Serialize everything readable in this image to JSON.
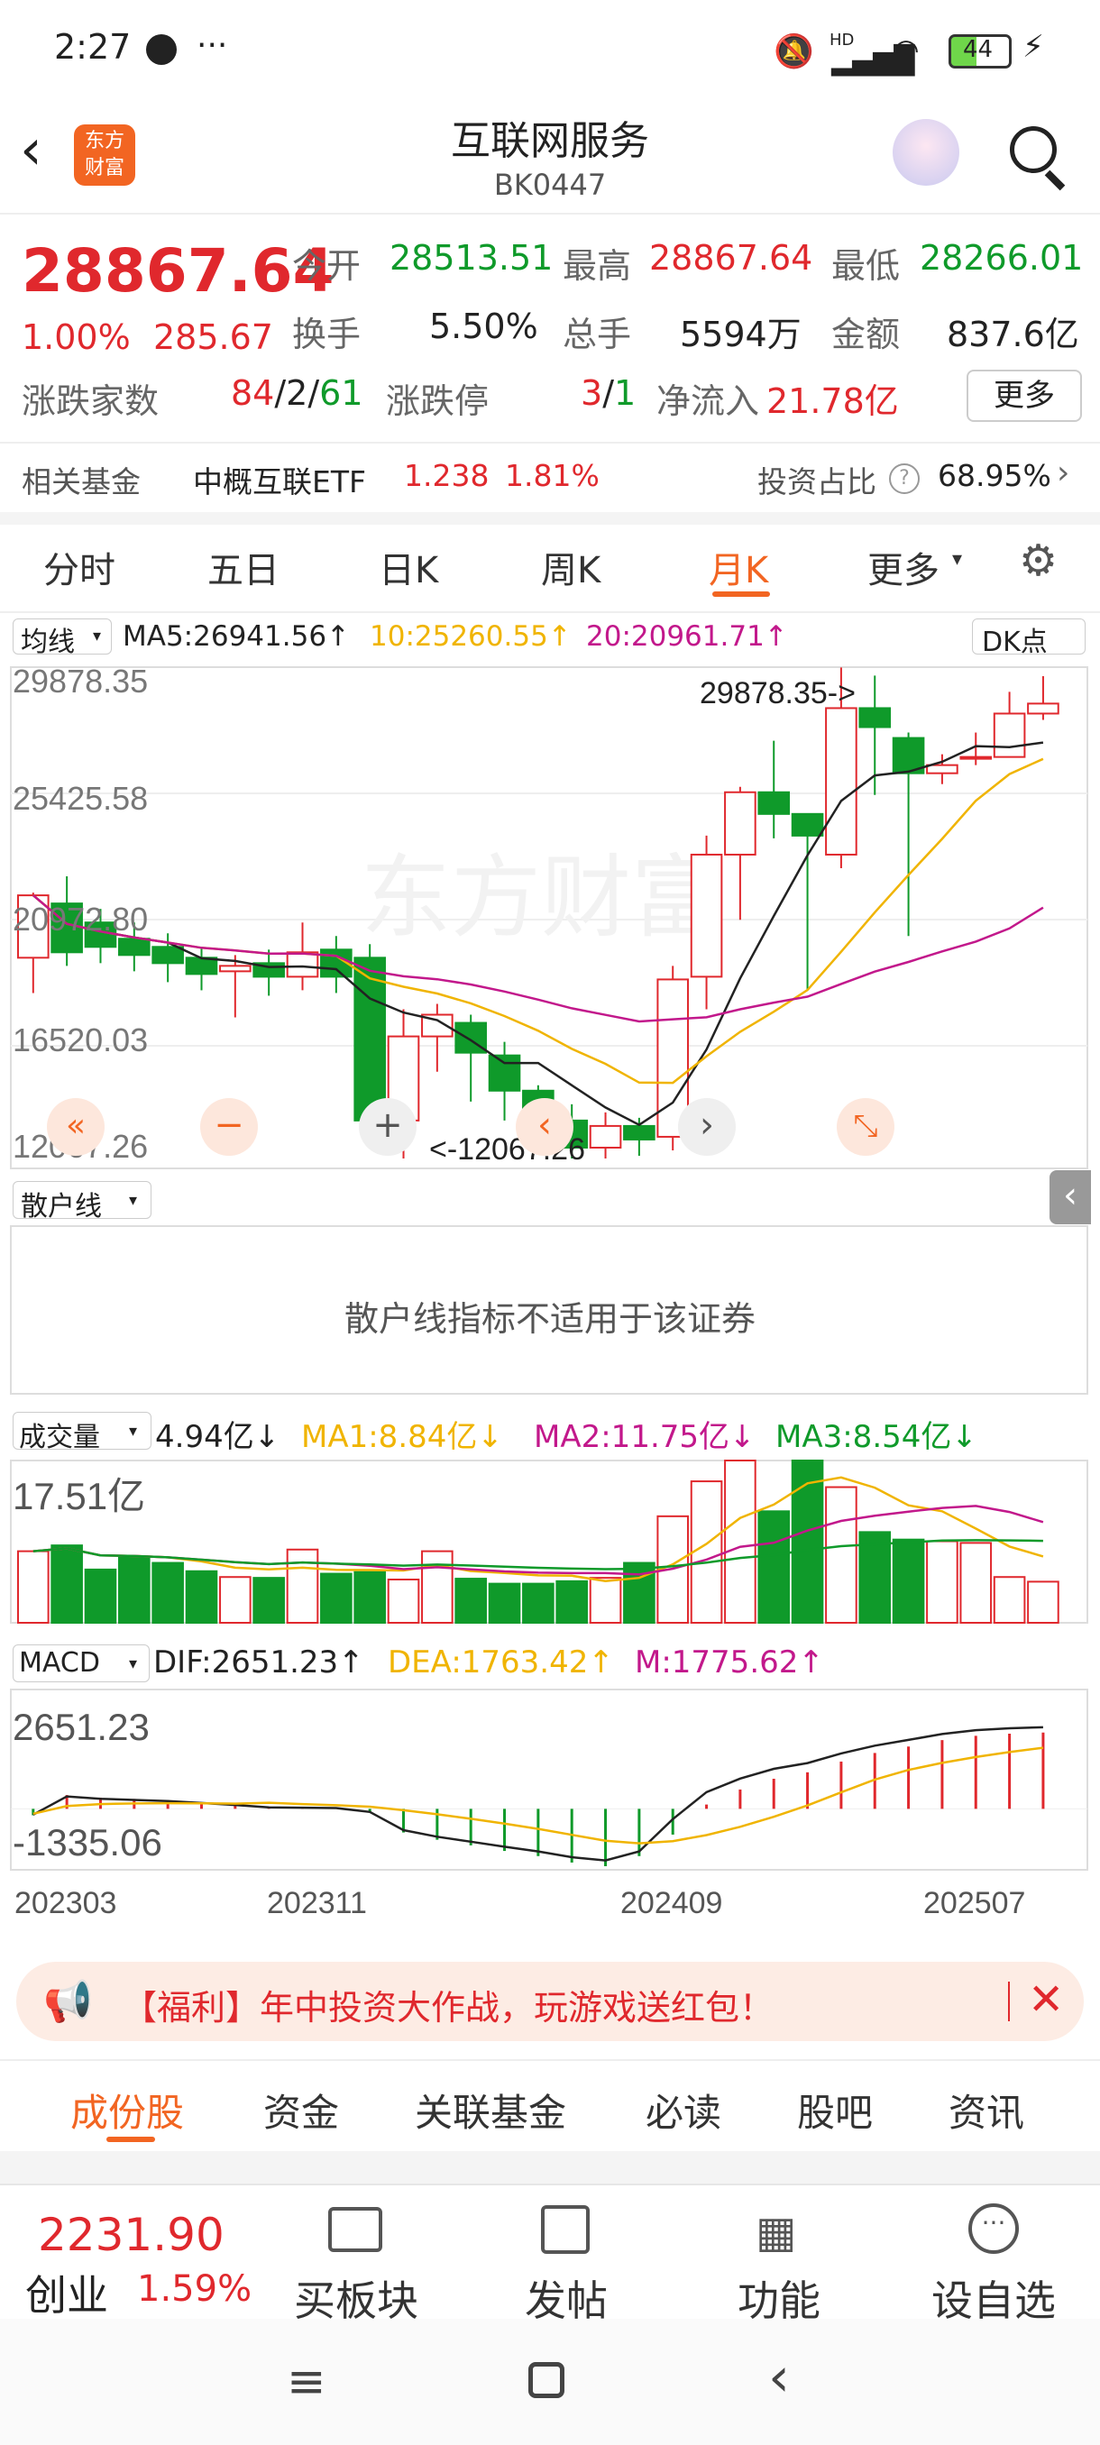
{
  "status_bar": {
    "time": "2:27",
    "dots": "···",
    "battery": "44",
    "net": "HD"
  },
  "header": {
    "title": "互联网服务",
    "code": "BK0447",
    "logo_line1": "东方",
    "logo_line2": "财富"
  },
  "quote": {
    "price": "28867.64",
    "pct": "1.00%",
    "change": "285.67",
    "open_label": "今开",
    "open": "28513.51",
    "high_label": "最高",
    "high": "28867.64",
    "low_label": "最低",
    "low": "28266.01",
    "turnover_label": "换手",
    "turnover": "5.50%",
    "volume_label": "总手",
    "volume": "5594万",
    "amount_label": "金额",
    "amount": "837.6亿",
    "updown_label": "涨跌家数",
    "up": "84",
    "flat": "2",
    "down": "61",
    "limit_label": "涨跌停",
    "limit_up": "3",
    "limit_down": "1",
    "inflow_label": "净流入",
    "inflow": "21.78亿",
    "more": "更多"
  },
  "fund": {
    "label": "相关基金",
    "name": "中概互联ETF",
    "price": "1.238",
    "pct": "1.81%",
    "ratio_label": "投资占比",
    "ratio": "68.95%"
  },
  "chart_tabs": [
    "分时",
    "五日",
    "日K",
    "周K",
    "月K",
    "更多"
  ],
  "active_tab": "月K",
  "ma": {
    "selector": "均线",
    "ma5": "MA5:26941.56↑",
    "ma10": "10:25260.55↑",
    "ma20": "20:20961.71↑",
    "dk": "DK点"
  },
  "kline": {
    "y_labels": [
      "29878.35",
      "25425.58",
      "20972.80",
      "16520.03",
      "12067.26"
    ],
    "max_note": "29878.35->",
    "min_note": "<-12067.26"
  },
  "retail": {
    "selector": "散户线",
    "message": "散户线指标不适用于该证券"
  },
  "volume": {
    "selector": "成交量",
    "value": "4.94亿↓",
    "ma1": "MA1:8.84亿↓",
    "ma2": "MA2:11.75亿↓",
    "ma3": "MA3:8.54亿↓",
    "y_label": "17.51亿"
  },
  "macd": {
    "selector": "MACD",
    "dif": "DIF:2651.23↑",
    "dea": "DEA:1763.42↑",
    "m": "M:1775.62↑",
    "top": "2651.23",
    "bottom": "-1335.06"
  },
  "x_dates": [
    "202303",
    "202311",
    "202409",
    "202507"
  ],
  "banner": {
    "text": "【福利】年中投资大作战，玩游戏送红包！"
  },
  "sub_tabs": [
    "成份股",
    "资金",
    "关联基金",
    "必读",
    "股吧",
    "资讯"
  ],
  "bottom_nav": {
    "index_price": "2231.90",
    "index_name": "创业",
    "index_pct": "1.59%",
    "items": [
      "买板块",
      "发帖",
      "功能",
      "设自选"
    ]
  },
  "colors": {
    "up": "#e0282d",
    "down": "#0f9a2a",
    "accent": "#f26522",
    "ma10": "#f0b400",
    "ma20": "#c2188b"
  },
  "chart_data": [
    {
      "type": "candlestick",
      "title": "",
      "period": "monthly",
      "series": [
        {
          "name": "K",
          "values": [
            [
              19500,
              21800,
              21900,
              18200
            ],
            [
              21500,
              19700,
              22500,
              19200
            ],
            [
              20800,
              19900,
              21300,
              19300
            ],
            [
              20200,
              19600,
              20800,
              19000
            ],
            [
              19900,
              19300,
              20400,
              18600
            ],
            [
              19500,
              18900,
              19900,
              18300
            ],
            [
              19000,
              19200,
              19600,
              17300
            ],
            [
              19300,
              18800,
              19800,
              18100
            ],
            [
              18800,
              19700,
              20800,
              18300
            ],
            [
              19800,
              18800,
              20300,
              18200
            ],
            [
              19500,
              13500,
              20000,
              13000
            ],
            [
              13500,
              16600,
              17600,
              12100
            ],
            [
              16600,
              17400,
              17800,
              15300
            ],
            [
              17100,
              16000,
              17400,
              14200
            ],
            [
              15900,
              14600,
              16400,
              13500
            ],
            [
              14600,
              13500,
              14800,
              12800
            ],
            [
              13500,
              12500,
              14100,
              12100
            ],
            [
              12500,
              13300,
              13800,
              12100
            ],
            [
              13300,
              12800,
              13600,
              12200
            ],
            [
              12900,
              18700,
              19200,
              12400
            ],
            [
              18800,
              23300,
              24000,
              17600
            ],
            [
              23300,
              25600,
              25800,
              20900
            ],
            [
              25600,
              24800,
              27500,
              23900
            ],
            [
              24800,
              24000,
              24800,
              18300
            ],
            [
              23300,
              28700,
              30200,
              22800
            ],
            [
              28700,
              28000,
              29900,
              25500
            ],
            [
              27600,
              26300,
              27800,
              20300
            ],
            [
              26300,
              26600,
              27000,
              25900
            ],
            [
              26900,
              26900,
              27800,
              26600
            ],
            [
              26900,
              28500,
              29300,
              26900
            ],
            [
              28500,
              28868,
              29878,
              28266
            ]
          ]
        }
      ],
      "ylim": [
        12067.26,
        29878.35
      ],
      "max": 29878.35,
      "min": 12067.26
    },
    {
      "type": "bar",
      "title": "",
      "series": [
        {
          "name": "成交量",
          "values": [
            8.6,
            9.3,
            6.4,
            7.8,
            7.2,
            6.2,
            5.5,
            5.4,
            8.8,
            5.9,
            6.1,
            5.2,
            8.6,
            5.3,
            4.7,
            4.7,
            5.0,
            5.4,
            7.2,
            12.8,
            17.0,
            20.6,
            13.4,
            20.0,
            16.3,
            10.9,
            10.0,
            9.8,
            9.6,
            5.5,
            4.94
          ]
        }
      ],
      "ylim": [
        0,
        17.51
      ]
    },
    {
      "type": "bar",
      "title": "MACD",
      "series": [
        {
          "name": "M",
          "values": [
            -150,
            320,
            260,
            230,
            200,
            150,
            100,
            40,
            30,
            20,
            -80,
            -550,
            -720,
            -850,
            -980,
            -1100,
            -1250,
            -1335,
            -1100,
            -600,
            100,
            450,
            700,
            850,
            1100,
            1300,
            1450,
            1600,
            1700,
            1750,
            1775.62
          ]
        }
      ],
      "ylim": [
        -1335.06,
        2651.23
      ]
    }
  ]
}
